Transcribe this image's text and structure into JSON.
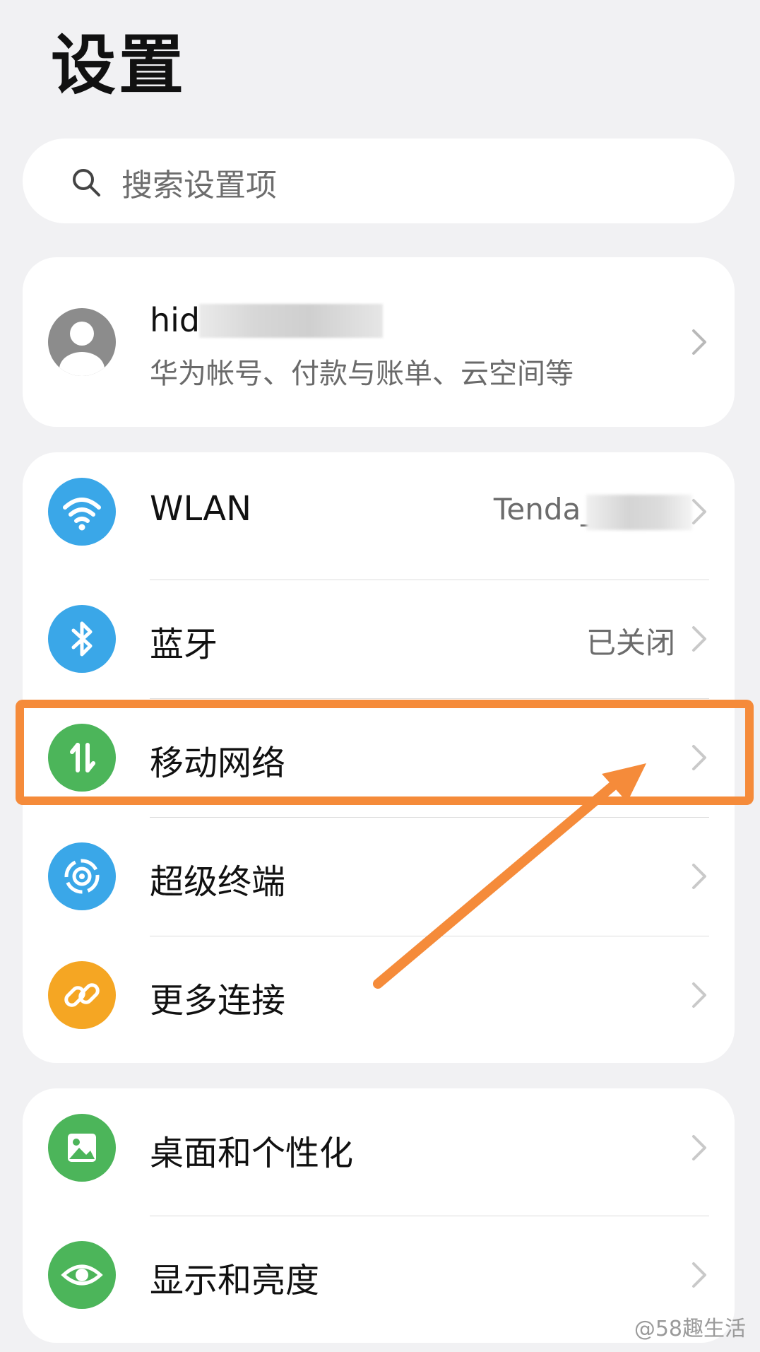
{
  "header": {
    "title": "设置"
  },
  "search": {
    "placeholder": "搜索设置项",
    "icon": "search-icon"
  },
  "account": {
    "name_prefix": "hid",
    "subtitle": "华为帐号、付款与账单、云空间等",
    "avatar_icon": "person-icon"
  },
  "connectivity": {
    "items": [
      {
        "label": "WLAN",
        "value": "Tenda_0",
        "icon": "wifi-icon",
        "color": "#3aa7e8"
      },
      {
        "label": "蓝牙",
        "value": "已关闭",
        "icon": "bluetooth-icon",
        "color": "#3aa7e8"
      },
      {
        "label": "移动网络",
        "value": "",
        "icon": "mobile-data-icon",
        "color": "#4cb55a"
      },
      {
        "label": "超级终端",
        "value": "",
        "icon": "super-device-icon",
        "color": "#3aa7e8"
      },
      {
        "label": "更多连接",
        "value": "",
        "icon": "link-icon",
        "color": "#f5a623"
      }
    ]
  },
  "personalization": {
    "items": [
      {
        "label": "桌面和个性化",
        "icon": "wallpaper-icon",
        "color": "#4cb55a"
      },
      {
        "label": "显示和亮度",
        "icon": "eye-icon",
        "color": "#4cb55a"
      }
    ]
  },
  "annotation": {
    "highlight_color": "#f58b3a"
  },
  "watermark": "@58趣生活"
}
